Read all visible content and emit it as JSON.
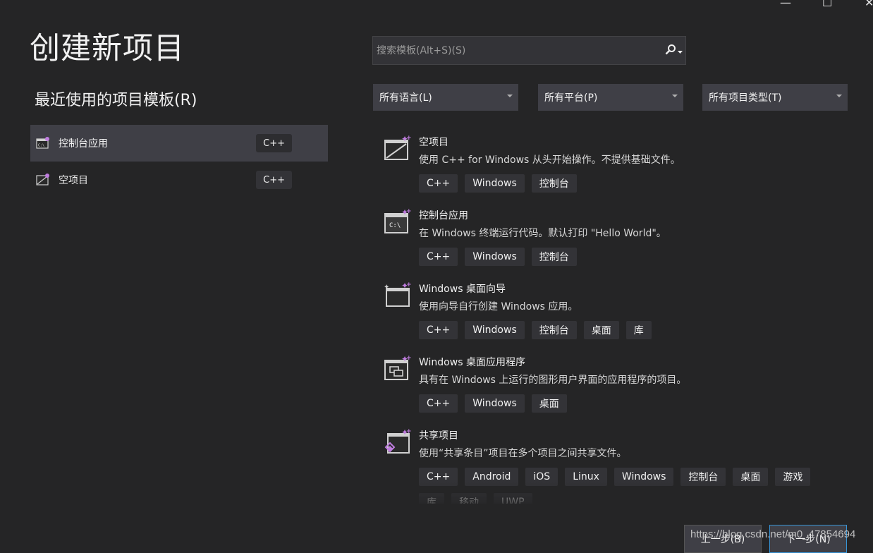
{
  "window_controls": {
    "minimize": "—",
    "maximize": "☐",
    "close": "✕"
  },
  "page_title": "创建新项目",
  "recent": {
    "title": "最近使用的项目模板(R)",
    "items": [
      {
        "label": "控制台应用",
        "tag": "C++",
        "icon": "console-app-icon",
        "selected": true
      },
      {
        "label": "空项目",
        "tag": "C++",
        "icon": "empty-project-icon",
        "selected": false
      }
    ]
  },
  "search": {
    "placeholder": "搜索模板(Alt+S)(S)",
    "icon": "search-icon"
  },
  "filters": {
    "language": "所有语言(L)",
    "platform": "所有平台(P)",
    "project_type": "所有项目类型(T)"
  },
  "templates": [
    {
      "name": "空项目",
      "desc": "使用 C++ for Windows 从头开始操作。不提供基础文件。",
      "icon": "empty-project-icon",
      "tags": [
        "C++",
        "Windows",
        "控制台"
      ]
    },
    {
      "name": "控制台应用",
      "desc": "在 Windows 终端运行代码。默认打印 \"Hello World\"。",
      "icon": "console-app-icon",
      "tags": [
        "C++",
        "Windows",
        "控制台"
      ]
    },
    {
      "name": "Windows 桌面向导",
      "desc": "使用向导自行创建 Windows 应用。",
      "icon": "desktop-wizard-icon",
      "tags": [
        "C++",
        "Windows",
        "控制台",
        "桌面",
        "库"
      ]
    },
    {
      "name": "Windows 桌面应用程序",
      "desc": "具有在 Windows 上运行的图形用户界面的应用程序的项目。",
      "icon": "desktop-app-icon",
      "tags": [
        "C++",
        "Windows",
        "桌面"
      ]
    },
    {
      "name": "共享项目",
      "desc": "使用“共享条目”项目在多个项目之间共享文件。",
      "icon": "shared-project-icon",
      "tags": [
        "C++",
        "Android",
        "iOS",
        "Linux",
        "Windows",
        "控制台",
        "桌面",
        "游戏",
        "库",
        "移动",
        "UWP"
      ]
    }
  ],
  "buttons": {
    "back": "上一步(B)",
    "next": "下一步(N)"
  },
  "watermark": "https://blog.csdn.net/m0_47854694",
  "colors": {
    "background": "#252526",
    "accent": "#3794d6",
    "tag_bg": "#333337",
    "selected_bg": "#3f3f46"
  }
}
